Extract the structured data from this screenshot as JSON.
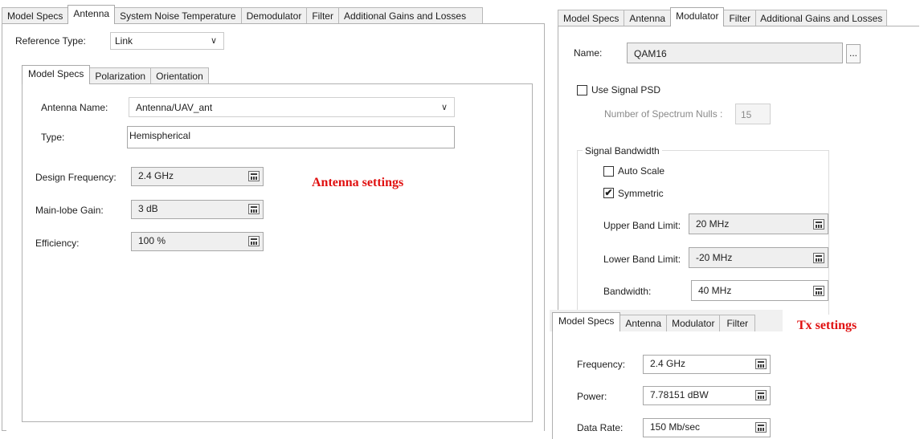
{
  "left": {
    "tabs": [
      "Model Specs",
      "Antenna",
      "System Noise Temperature",
      "Demodulator",
      "Filter",
      "Additional Gains and Losses"
    ],
    "active_tab": "Antenna",
    "reference_type_label": "Reference Type:",
    "reference_type_value": "Link",
    "sub_tabs": [
      "Model Specs",
      "Polarization",
      "Orientation"
    ],
    "antenna_name_label": "Antenna Name:",
    "antenna_name_value": "Antenna/UAV_ant",
    "type_label": "Type:",
    "type_value": "Hemispherical",
    "design_frequency_label": "Design Frequency:",
    "design_frequency_value": "2.4 GHz",
    "main_lobe_gain_label": "Main-lobe Gain:",
    "main_lobe_gain_value": "3 dB",
    "efficiency_label": "Efficiency:",
    "efficiency_value": "100 %",
    "annotation": "Antenna settings"
  },
  "right": {
    "tabs": [
      "Model Specs",
      "Antenna",
      "Modulator",
      "Filter",
      "Additional Gains and Losses"
    ],
    "active_tab": "Modulator",
    "name_label": "Name:",
    "name_value": "QAM16",
    "browse_label": "...",
    "use_signal_psd_label": "Use Signal PSD",
    "spectrum_nulls_label": "Number of Spectrum Nulls :",
    "spectrum_nulls_value": "15",
    "signal_bandwidth_label": "Signal Bandwidth",
    "auto_scale_label": "Auto Scale",
    "symmetric_label": "Symmetric",
    "symmetric_check": "✔",
    "upper_band_label": "Upper Band Limit:",
    "upper_band_value": "20 MHz",
    "lower_band_label": "Lower Band Limit:",
    "lower_band_value": "-20 MHz",
    "bandwidth_label": "Bandwidth:",
    "bandwidth_value": "40 MHz"
  },
  "tx": {
    "tabs": [
      "Model Specs",
      "Antenna",
      "Modulator",
      "Filter"
    ],
    "active_tab": "Model Specs",
    "annotation": "Tx settings",
    "frequency_label": "Frequency:",
    "frequency_value": "2.4 GHz",
    "power_label": "Power:",
    "power_value": "7.78151 dBW",
    "data_rate_label": "Data Rate:",
    "data_rate_value": "150 Mb/sec"
  },
  "colors": {
    "annotation_red": "#e01010",
    "panel_border": "#b0b0b0",
    "field_bg": "#efefef"
  },
  "icons": [
    "dropdown-chevron-icon",
    "calculator-icon",
    "checkmark-icon"
  ]
}
